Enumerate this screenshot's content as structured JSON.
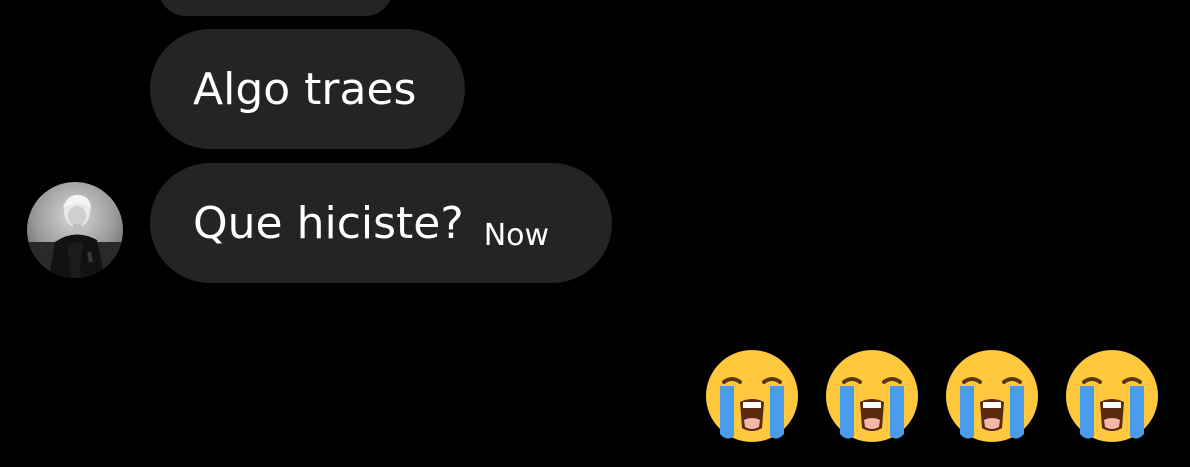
{
  "conversation": {
    "messages": [
      {
        "text": "Algo traes"
      },
      {
        "text": "Que hiciste?",
        "time": "Now"
      }
    ],
    "reaction_emojis": [
      "loudly-crying-face-icon",
      "loudly-crying-face-icon",
      "loudly-crying-face-icon",
      "loudly-crying-face-icon"
    ]
  },
  "colors": {
    "background": "#000000",
    "bubble": "#242427",
    "text": "#ffffff",
    "emoji_face": "#FFC83D",
    "emoji_tears": "#4A9BEA"
  }
}
